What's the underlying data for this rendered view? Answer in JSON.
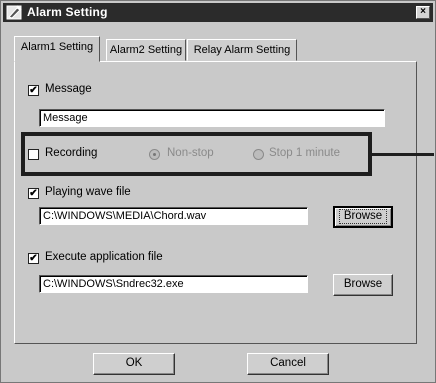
{
  "window": {
    "title": "Alarm Setting",
    "close_glyph": "×"
  },
  "tabs": [
    {
      "label": "Alarm1 Setting",
      "active": true
    },
    {
      "label": "Alarm2 Setting",
      "active": false
    },
    {
      "label": "Relay Alarm Setting",
      "active": false
    }
  ],
  "message": {
    "checked": true,
    "label": "Message",
    "value": "Message"
  },
  "recording": {
    "checked": false,
    "label": "Recording",
    "options": [
      {
        "label": "Non-stop",
        "selected": true
      },
      {
        "label": "Stop 1 minute",
        "selected": false
      }
    ]
  },
  "wave": {
    "checked": true,
    "label": "Playing wave file",
    "value": "C:\\WINDOWS\\MEDIA\\Chord.wav",
    "browse_label": "Browse"
  },
  "application": {
    "checked": true,
    "label": "Execute application file",
    "value": "C:\\WINDOWS\\Sndrec32.exe",
    "browse_label": "Browse"
  },
  "buttons": {
    "ok_label": "OK",
    "cancel_label": "Cancel"
  },
  "check_glyph": "✔"
}
